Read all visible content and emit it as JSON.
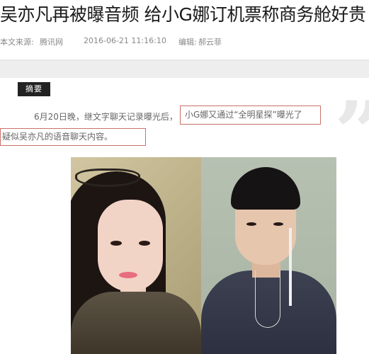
{
  "article": {
    "headline": "吴亦凡再被曝音频 给小G娜订机票称商务舱好贵",
    "meta": {
      "source_label": "本文来源:",
      "source": "腾讯网",
      "date": "2016-06-21 11:16:10",
      "editor_label": "编辑:",
      "editor": "郝云菲"
    },
    "summary_label": "摘要",
    "quote_glyph": "”",
    "paragraph": {
      "line1_start": "6月20日晚，继文字聊天记录曝光后，",
      "line1_highlight": "小G娜又通过“全明星探”曝光了",
      "line2_highlight": "疑似吴亦凡的语音聊天内容。"
    }
  },
  "colors": {
    "highlight_border": "#c97268",
    "badge_bg": "#222222",
    "text_gray": "#666666"
  }
}
